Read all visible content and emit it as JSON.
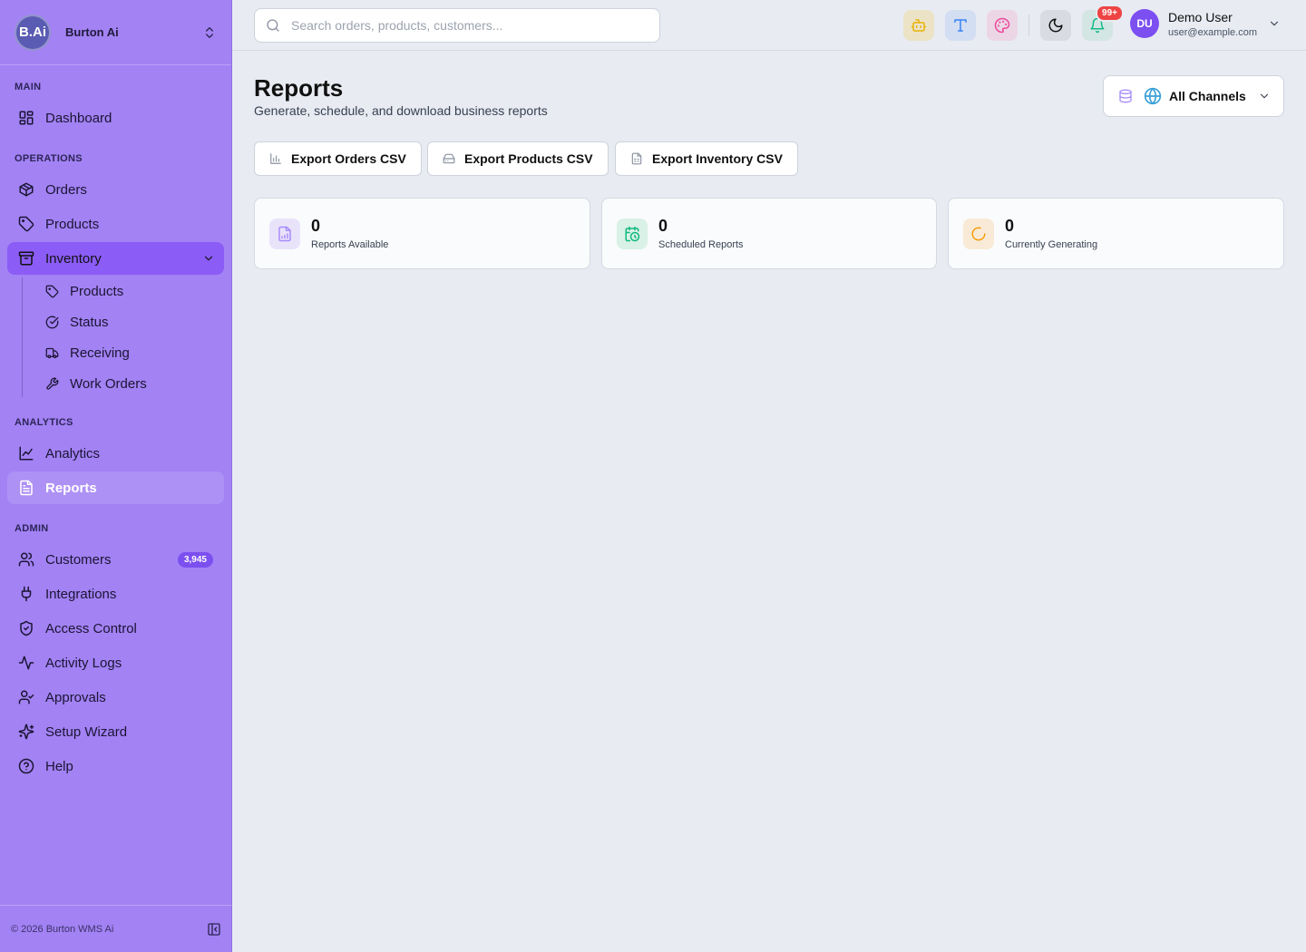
{
  "brand": {
    "logo": "B.Ai",
    "name": "Burton Ai"
  },
  "sidebar": {
    "sections": {
      "main": "MAIN",
      "operations": "OPERATIONS",
      "analytics": "ANALYTICS",
      "admin": "ADMIN"
    },
    "items": {
      "dashboard": "Dashboard",
      "orders": "Orders",
      "products": "Products",
      "inventory": "Inventory",
      "analytics": "Analytics",
      "reports": "Reports",
      "customers": "Customers",
      "customers_badge": "3,945",
      "integrations": "Integrations",
      "access_control": "Access Control",
      "activity_logs": "Activity Logs",
      "approvals": "Approvals",
      "setup_wizard": "Setup Wizard",
      "help": "Help"
    },
    "inventory_sub": {
      "products": "Products",
      "status": "Status",
      "receiving": "Receiving",
      "work_orders": "Work Orders"
    },
    "footer": "© 2026 Burton WMS Ai"
  },
  "topbar": {
    "search_placeholder": "Search orders, products, customers...",
    "notifications_badge": "99+",
    "user": {
      "initials": "DU",
      "name": "Demo User",
      "email": "user@example.com"
    }
  },
  "page": {
    "title": "Reports",
    "subtitle": "Generate, schedule, and download business reports",
    "channel_selector": "All Channels",
    "exports": {
      "orders": "Export Orders CSV",
      "products": "Export Products CSV",
      "inventory": "Export Inventory CSV"
    },
    "stats": {
      "available": {
        "value": "0",
        "label": "Reports Available"
      },
      "scheduled": {
        "value": "0",
        "label": "Scheduled Reports"
      },
      "generating": {
        "value": "0",
        "label": "Currently Generating"
      }
    }
  },
  "colors": {
    "sidebar_bg": "#a382f4",
    "accent": "#7c4ff0",
    "active_parent": "#8b5cf6",
    "page_bg": "#e8ebf2",
    "notification": "#ef4444"
  }
}
